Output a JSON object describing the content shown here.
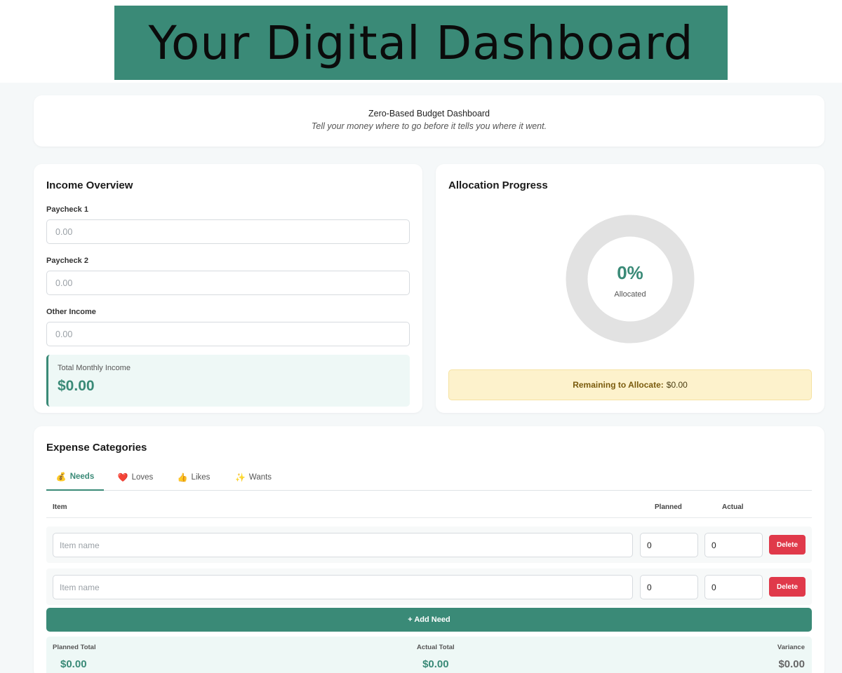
{
  "banner": {
    "title": "Your Digital Dashboard"
  },
  "header": {
    "title": "Zero-Based Budget Dashboard",
    "subtitle": "Tell your money where to go before it tells you where it went."
  },
  "income": {
    "title": "Income Overview",
    "fields": [
      {
        "label": "Paycheck 1",
        "placeholder": "0.00"
      },
      {
        "label": "Paycheck 2",
        "placeholder": "0.00"
      },
      {
        "label": "Other Income",
        "placeholder": "0.00"
      }
    ],
    "total_label": "Total Monthly Income",
    "total_value": "$0.00"
  },
  "allocation": {
    "title": "Allocation Progress",
    "percent": "0%",
    "percent_value": 0,
    "caption": "Allocated",
    "remaining_label": "Remaining to Allocate:",
    "remaining_value": "$0.00"
  },
  "expenses": {
    "title": "Expense Categories",
    "tabs": [
      {
        "icon": "💰",
        "icon_name": "money-bag-icon",
        "label": "Needs"
      },
      {
        "icon": "❤️",
        "icon_name": "heart-icon",
        "label": "Loves"
      },
      {
        "icon": "👍",
        "icon_name": "thumbs-up-icon",
        "label": "Likes"
      },
      {
        "icon": "✨",
        "icon_name": "sparkles-icon",
        "label": "Wants"
      }
    ],
    "columns": {
      "item": "Item",
      "planned": "Planned",
      "actual": "Actual"
    },
    "rows": [
      {
        "name_placeholder": "Item name",
        "planned": "0",
        "actual": "0",
        "delete_label": "Delete"
      },
      {
        "name_placeholder": "Item name",
        "planned": "0",
        "actual": "0",
        "delete_label": "Delete"
      }
    ],
    "add_label": "+ Add Need",
    "summary": {
      "planned_label": "Planned Total",
      "planned_value": "$0.00",
      "actual_label": "Actual Total",
      "actual_value": "$0.00",
      "variance_label": "Variance",
      "variance_value": "$0.00"
    }
  },
  "colors": {
    "accent": "#3a8a77",
    "delete": "#e0394a",
    "warning_bg": "#fdf2cc",
    "ring_track": "#e2e2e2"
  }
}
